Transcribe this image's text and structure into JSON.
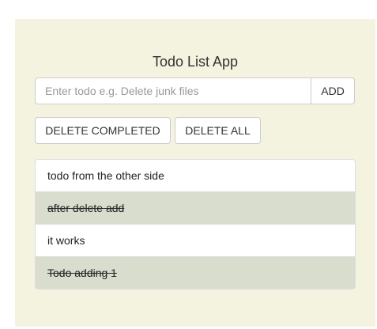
{
  "app": {
    "title": "Todo List App"
  },
  "input": {
    "value": "",
    "placeholder": "Enter todo e.g. Delete junk files",
    "add_label": "ADD"
  },
  "actions": {
    "delete_completed_label": "DELETE COMPLETED",
    "delete_all_label": "DELETE ALL"
  },
  "todos": [
    {
      "text": "todo from the other side",
      "completed": false
    },
    {
      "text": "after delete add",
      "completed": true
    },
    {
      "text": "it works",
      "completed": false
    },
    {
      "text": "Todo adding 1",
      "completed": true
    }
  ],
  "colors": {
    "panel_background": "#f4f3df",
    "completed_background": "#d8ddcd"
  }
}
